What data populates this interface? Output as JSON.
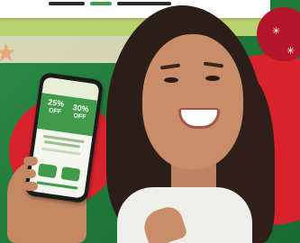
{
  "scene": {
    "description_visible": false
  },
  "phone_screen": {
    "promo_left": "25%",
    "promo_right": "30%",
    "promo_left_sub": "OFF",
    "promo_right_sub": "OFF"
  },
  "colors": {
    "background_green": "#1f7a3a",
    "accent_red": "#d8232b",
    "lime": "#b8d36e",
    "cream": "#f2e6c8"
  }
}
